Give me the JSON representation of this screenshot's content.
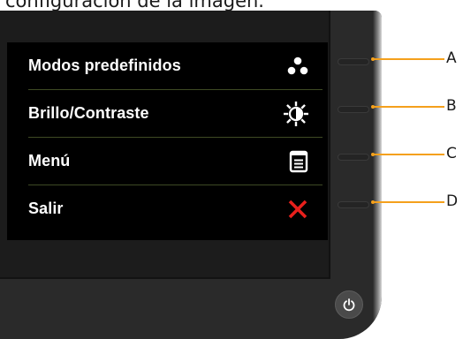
{
  "caption": "configuración de la imagen.",
  "osd_menu": {
    "items": [
      {
        "label": "Modos predefinidos",
        "icon": "preset-modes-icon"
      },
      {
        "label": "Brillo/Contraste",
        "icon": "brightness-contrast-icon"
      },
      {
        "label": "Menú",
        "icon": "menu-icon"
      },
      {
        "label": "Salir",
        "icon": "exit-icon"
      }
    ]
  },
  "callouts": [
    "A",
    "B",
    "C",
    "D"
  ],
  "colors": {
    "osd_background": "#000000",
    "label_text": "#ffffff",
    "divider": "#3e4a24",
    "exit_icon": "#e8201c",
    "leader_line": "#f4a01c",
    "bezel": "#2a2a2a"
  }
}
